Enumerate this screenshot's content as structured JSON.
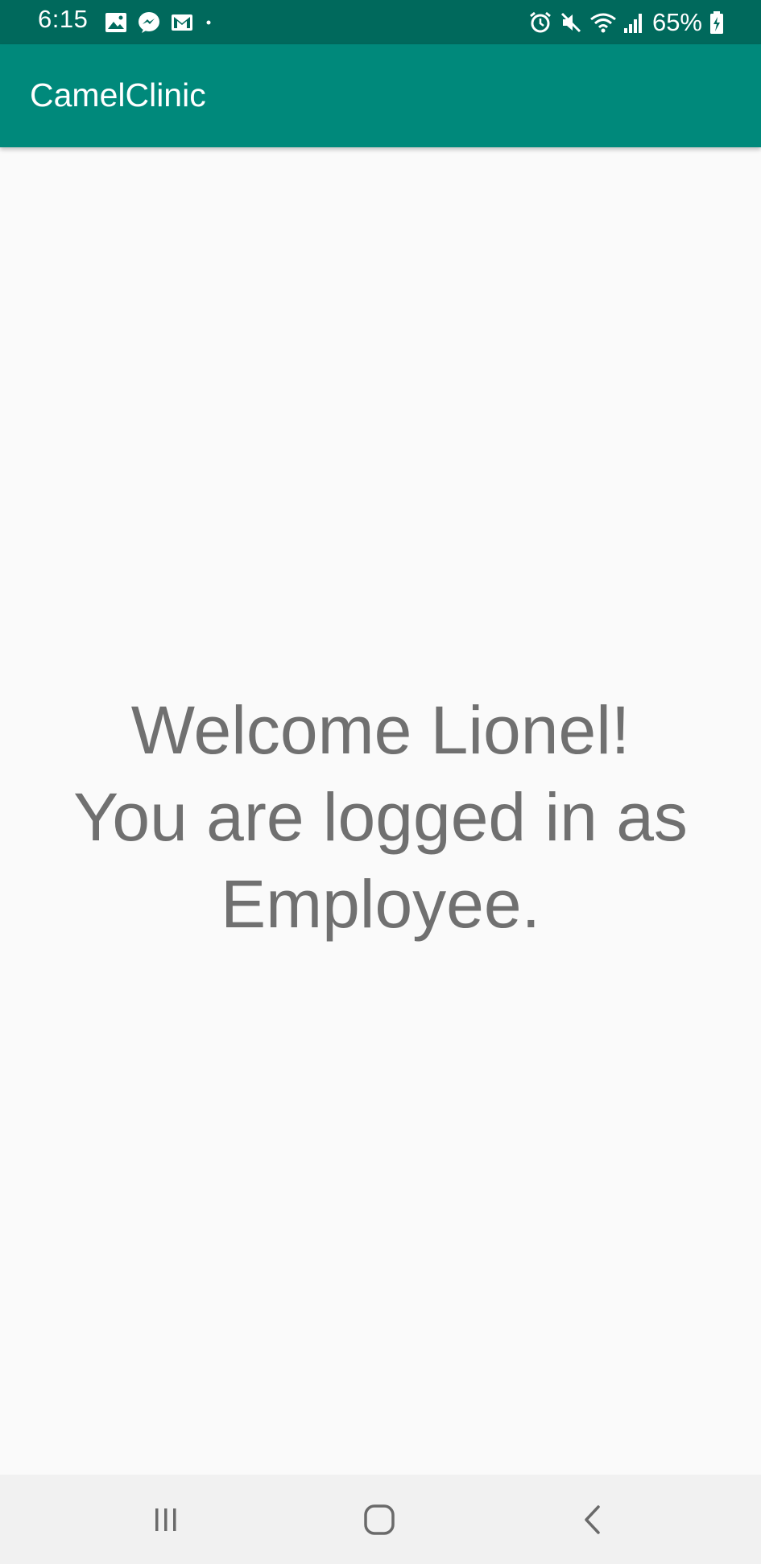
{
  "status_bar": {
    "time": "6:15",
    "left_icons": [
      "image-icon",
      "messenger-icon",
      "gmail-icon",
      "dot-icon"
    ],
    "right_icons": [
      "alarm-icon",
      "mute-icon",
      "wifi-icon",
      "signal-icon",
      "battery-icon"
    ],
    "battery_percent": "65%"
  },
  "app_bar": {
    "title": "CamelClinic",
    "color": "#00897b",
    "status_color": "#00695c"
  },
  "main": {
    "welcome_line1": "Welcome Lionel!",
    "welcome_line2": "You are logged in as",
    "welcome_line3": "Employee."
  },
  "nav_bar": {
    "buttons": [
      "recent-apps-icon",
      "home-icon",
      "back-icon"
    ]
  }
}
